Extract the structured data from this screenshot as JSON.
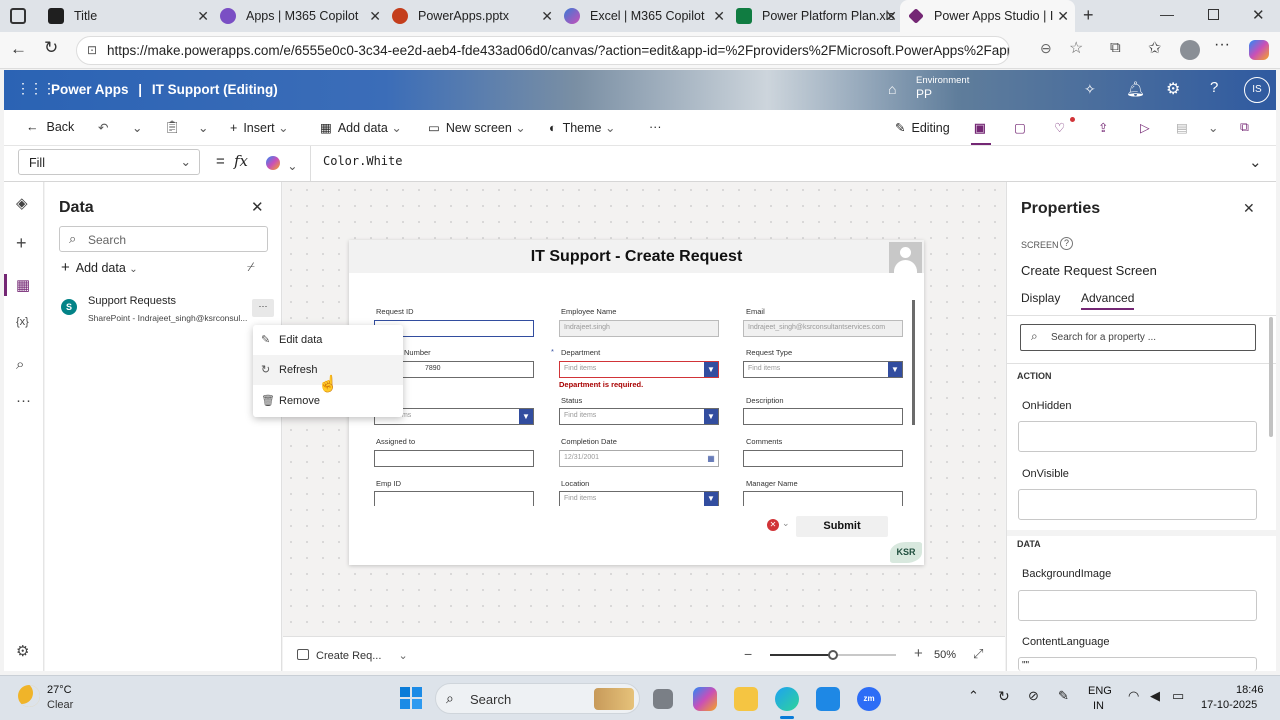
{
  "browser": {
    "tabs": [
      {
        "title": "Title",
        "color": "#1f1f1f"
      },
      {
        "title": "Apps | M365 Copilot",
        "color": "#7a4fc4"
      },
      {
        "title": "PowerApps.pptx",
        "color": "#c43e1c"
      },
      {
        "title": "Excel | M365 Copilot",
        "color": "#3a7bd5"
      },
      {
        "title": "Power Platform Plan.xls",
        "color": "#107c41"
      },
      {
        "title": "Power Apps Studio | I",
        "color": "#742774"
      }
    ],
    "url": "https://make.powerapps.com/e/6555e0c0-3c34-ee2d-aeb4-fde433ad06d0/canvas/?action=edit&app-id=%2Fproviders%2FMicrosoft.PowerApps%2Fapp..."
  },
  "header": {
    "app": "Power Apps",
    "separator": "|",
    "title": "IT Support (Editing)",
    "env_label": "Environment",
    "env_value": "PP",
    "user_initials": "IS"
  },
  "toolbar": {
    "back": "Back",
    "insert": "Insert",
    "add_data": "Add data",
    "new_screen": "New screen",
    "theme": "Theme",
    "more": "···",
    "editing": "Editing"
  },
  "formula": {
    "property": "Fill",
    "equals": "=",
    "fx": "fx",
    "value": "Color.White"
  },
  "data_pane": {
    "title": "Data",
    "search_placeholder": "Search",
    "add_data": "Add data",
    "source_name": "Support Requests",
    "source_detail": "SharePoint - Indrajeet_singh@ksrconsul...",
    "more": "···"
  },
  "context_menu": {
    "items": [
      "Edit data",
      "Refresh",
      "Remove"
    ]
  },
  "form": {
    "title": "IT Support - Create Request",
    "fields": [
      {
        "label": "Request ID",
        "value": ""
      },
      {
        "label": "Employee Name",
        "value": "Indrajeet.singh"
      },
      {
        "label": "Email",
        "value": "Indrajeet_singh@ksrconsultantservices.com"
      },
      {
        "label": "Number",
        "value": "7890"
      },
      {
        "label": "Department",
        "value": "Find items"
      },
      {
        "label": "Request Type",
        "value": "Find items"
      },
      {
        "label": "",
        "value": "Find items"
      },
      {
        "label": "Status",
        "value": "Find items"
      },
      {
        "label": "Description",
        "value": ""
      },
      {
        "label": "Assigned to",
        "value": ""
      },
      {
        "label": "Completion Date",
        "value": "12/31/2001"
      },
      {
        "label": "Comments",
        "value": ""
      },
      {
        "label": "Emp ID",
        "value": ""
      },
      {
        "label": "Location",
        "value": "Find items"
      },
      {
        "label": "Manager Name",
        "value": ""
      }
    ],
    "error": "Department is required.",
    "required_mark": "*",
    "submit": "Submit",
    "logo": "KSR"
  },
  "status_bar": {
    "screen_name": "Create Req...",
    "zoom": "50%",
    "zoom_fraction": 0.5
  },
  "properties": {
    "title": "Properties",
    "type": "SCREEN",
    "screen_name": "Create Request Screen",
    "tabs": [
      "Display",
      "Advanced"
    ],
    "active_tab": "Advanced",
    "search_placeholder": "Search for a property ...",
    "section_action": "ACTION",
    "on_hidden": "OnHidden",
    "on_visible": "OnVisible",
    "section_data": "DATA",
    "background_image": "BackgroundImage",
    "content_language": "ContentLanguage",
    "content_language_value": "\"\""
  },
  "taskbar": {
    "temp": "27°C",
    "weather": "Clear",
    "search": "Search",
    "lang": "ENG",
    "region": "IN",
    "time": "18:46",
    "date": "17-10-2025"
  },
  "colors": {
    "brand": "#742774",
    "accent": "#324d9f",
    "error": "#a80000"
  }
}
